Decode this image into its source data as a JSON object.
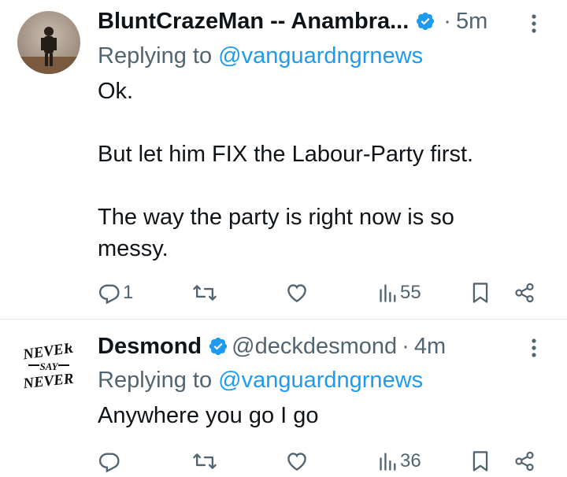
{
  "tweets": [
    {
      "name": "BluntCrazeMan -- Anambra...",
      "handle": "",
      "time": "5m",
      "replying_prefix": "Replying to",
      "replying_to": "@vanguardngrnews",
      "body": [
        "Ok.",
        "",
        "But let him FIX the Labour-Party first.",
        "",
        "The way the party is right now is so",
        "messy."
      ],
      "replies": "1",
      "reposts": "",
      "likes": "",
      "views": "55"
    },
    {
      "name": "Desmond",
      "handle": "@deckdesmond",
      "time": "4m",
      "replying_prefix": "Replying to",
      "replying_to": "@vanguardngrnews",
      "body": [
        "Anywhere you go I go"
      ],
      "replies": "",
      "reposts": "",
      "likes": "",
      "views": "36",
      "avatar_text": [
        "NEVER",
        "SAY",
        "NEVER"
      ]
    }
  ],
  "icons": {
    "verified": "verified-badge-icon",
    "more": "more-vertical-icon",
    "reply": "reply-icon",
    "repost": "repost-icon",
    "like": "heart-icon",
    "views": "views-icon",
    "bookmark": "bookmark-icon",
    "share": "share-icon"
  },
  "colors": {
    "link": "#1d9bf0",
    "secondary": "#536471",
    "verified": "#1d9bf0",
    "text": "#0f1419"
  }
}
